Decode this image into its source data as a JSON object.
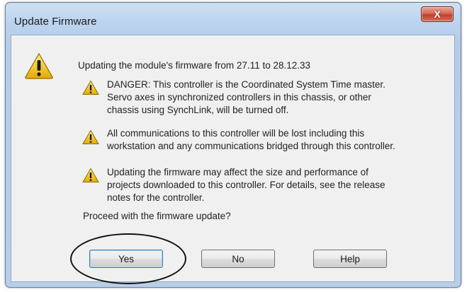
{
  "window": {
    "title": "Update Firmware",
    "close_icon": "close-icon",
    "close_glyph": "X"
  },
  "message": {
    "main_icon": "warning-icon",
    "headline": "Updating the module's firmware from 27.11 to 28.12.33",
    "warnings": [
      {
        "icon": "warning-icon",
        "lines": [
          "DANGER: This controller is the Coordinated System Time master.",
          "Servo axes in synchronized controllers in this chassis, or other",
          "chassis using SynchLink, will be turned off."
        ]
      },
      {
        "icon": "warning-icon",
        "lines": [
          "All communications to this controller will be lost including this",
          "workstation and any communications bridged through this controller."
        ]
      },
      {
        "icon": "warning-icon",
        "lines": [
          "Updating the firmware may affect the size and performance of",
          "projects downloaded to this controller.  For details, see the release",
          "notes for the controller."
        ]
      }
    ],
    "prompt": "Proceed with the firmware update?"
  },
  "buttons": {
    "yes": "Yes",
    "no": "No",
    "help": "Help"
  },
  "colors": {
    "frame": "#b8cfea",
    "client": "#f0f0f0",
    "close_red": "#c0402b",
    "warning_yellow": "#f5c400"
  }
}
